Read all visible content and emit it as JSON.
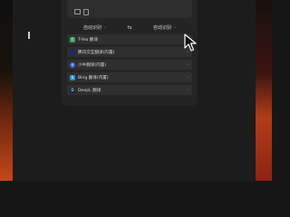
{
  "input": {
    "copy_icon": "copy-icon",
    "clipboard_icon": "clipboard-icon"
  },
  "language_bar": {
    "source": "自动识别",
    "target": "自动识别",
    "swap_symbol": "⇆",
    "chevron": "›"
  },
  "services": [
    {
      "name": "T-Yea 翻译",
      "icon": "t",
      "color": "#3aa55c"
    },
    {
      "name": "腾讯交互翻译(内置)",
      "icon": "",
      "color": "#1d2a6a"
    },
    {
      "name": "小牛翻译(内置)",
      "icon": "n",
      "color": "#3b6ad9"
    },
    {
      "name": "Bing 翻译(内置)",
      "icon": "b",
      "color": "#2a8fd0"
    },
    {
      "name": "DeepL 翻译",
      "icon": "D",
      "color": "#0f2b46"
    }
  ],
  "service_chevron": "›"
}
